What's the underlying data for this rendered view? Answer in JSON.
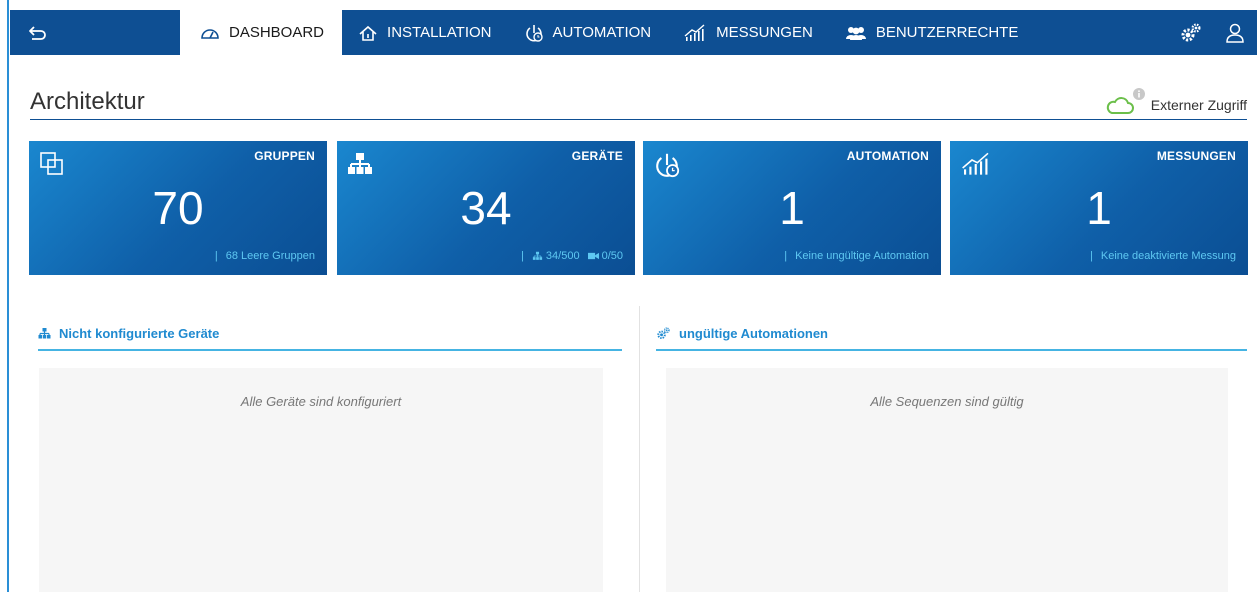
{
  "nav": {
    "tabs": [
      {
        "label": "DASHBOARD",
        "icon": "gauge-icon",
        "active": true
      },
      {
        "label": "INSTALLATION",
        "icon": "house-icon",
        "active": false
      },
      {
        "label": "AUTOMATION",
        "icon": "power-clock-icon",
        "active": false
      },
      {
        "label": "MESSUNGEN",
        "icon": "signal-chart-icon",
        "active": false
      },
      {
        "label": "BENUTZERRECHTE",
        "icon": "users-icon",
        "active": false
      }
    ]
  },
  "page": {
    "title": "Architektur",
    "external_access": "Externer Zugriff"
  },
  "cards": [
    {
      "title": "GRUPPEN",
      "value": "70",
      "footer": "68 Leere Gruppen",
      "icon": "groups-icon"
    },
    {
      "title": "GERÄTE",
      "value": "34",
      "footer_devices": "34/500",
      "footer_cameras": "0/50",
      "icon": "network-icon"
    },
    {
      "title": "AUTOMATION",
      "value": "1",
      "footer": "Keine ungültige Automation",
      "icon": "power-clock-icon"
    },
    {
      "title": "MESSUNGEN",
      "value": "1",
      "footer": "Keine deaktivierte Messung",
      "icon": "signal-chart-icon"
    }
  ],
  "panels": {
    "left": {
      "title": "Nicht konfigurierte Geräte",
      "empty": "Alle Geräte sind konfiguriert"
    },
    "right": {
      "title": "ungültige Automationen",
      "empty": "Alle Sequenzen sind gültig"
    }
  },
  "colors": {
    "nav": "#0e4f93",
    "card_gradient_start": "#1a87cf",
    "card_gradient_end": "#0b4e93",
    "accent": "#1f8ad0",
    "cloud": "#6bbf4a"
  }
}
